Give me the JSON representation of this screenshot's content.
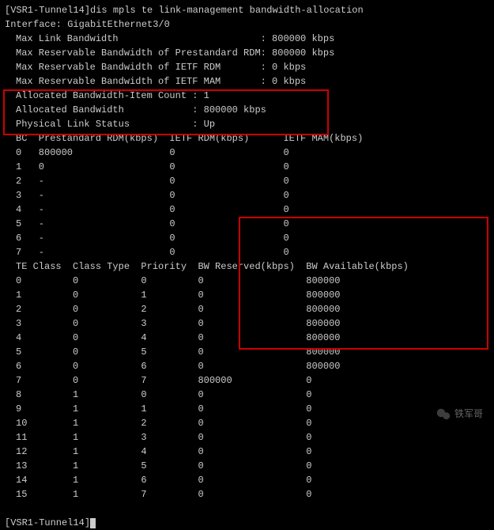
{
  "prompt1": "[VSR1-Tunnel14]",
  "command": "dis mpls te link-management bandwidth-allocation",
  "interface_line": "Interface: GigabitEthernet3/0",
  "header_rows": [
    {
      "label": "Max Link Bandwidth",
      "value": ": 800000 kbps"
    },
    {
      "label": "Max Reservable Bandwidth of Prestandard RDM",
      "value": ": 800000 kbps"
    },
    {
      "label": "Max Reservable Bandwidth of IETF RDM",
      "value": ": 0 kbps"
    },
    {
      "label": "Max Reservable Bandwidth of IETF MAM",
      "value": ": 0 kbps"
    },
    {
      "label": "Allocated Bandwidth-Item Count",
      "value": ": 1"
    },
    {
      "label": "Allocated Bandwidth",
      "value": ": 800000 kbps"
    },
    {
      "label": "Physical Link Status",
      "value": ": Up"
    }
  ],
  "bc_header": {
    "c0": "BC",
    "c1": "Prestandard RDM(kbps)",
    "c2": "IETF RDM(kbps)",
    "c3": "IETF MAM(kbps)"
  },
  "bc_rows": [
    {
      "bc": "0",
      "pre": "800000",
      "ietf_rdm": "0",
      "ietf_mam": "0"
    },
    {
      "bc": "1",
      "pre": "0",
      "ietf_rdm": "0",
      "ietf_mam": "0"
    },
    {
      "bc": "2",
      "pre": "-",
      "ietf_rdm": "0",
      "ietf_mam": "0"
    },
    {
      "bc": "3",
      "pre": "-",
      "ietf_rdm": "0",
      "ietf_mam": "0"
    },
    {
      "bc": "4",
      "pre": "-",
      "ietf_rdm": "0",
      "ietf_mam": "0"
    },
    {
      "bc": "5",
      "pre": "-",
      "ietf_rdm": "0",
      "ietf_mam": "0"
    },
    {
      "bc": "6",
      "pre": "-",
      "ietf_rdm": "0",
      "ietf_mam": "0"
    },
    {
      "bc": "7",
      "pre": "-",
      "ietf_rdm": "0",
      "ietf_mam": "0"
    }
  ],
  "te_header": {
    "c0": "TE Class",
    "c1": "Class Type",
    "c2": "Priority",
    "c3": "BW Reserved(kbps)",
    "c4": "BW Available(kbps)"
  },
  "te_rows": [
    {
      "cls": "0",
      "type": "0",
      "pri": "0",
      "res": "0",
      "avail": "800000"
    },
    {
      "cls": "1",
      "type": "0",
      "pri": "1",
      "res": "0",
      "avail": "800000"
    },
    {
      "cls": "2",
      "type": "0",
      "pri": "2",
      "res": "0",
      "avail": "800000"
    },
    {
      "cls": "3",
      "type": "0",
      "pri": "3",
      "res": "0",
      "avail": "800000"
    },
    {
      "cls": "4",
      "type": "0",
      "pri": "4",
      "res": "0",
      "avail": "800000"
    },
    {
      "cls": "5",
      "type": "0",
      "pri": "5",
      "res": "0",
      "avail": "800000"
    },
    {
      "cls": "6",
      "type": "0",
      "pri": "6",
      "res": "0",
      "avail": "800000"
    },
    {
      "cls": "7",
      "type": "0",
      "pri": "7",
      "res": "800000",
      "avail": "0"
    },
    {
      "cls": "8",
      "type": "1",
      "pri": "0",
      "res": "0",
      "avail": "0"
    },
    {
      "cls": "9",
      "type": "1",
      "pri": "1",
      "res": "0",
      "avail": "0"
    },
    {
      "cls": "10",
      "type": "1",
      "pri": "2",
      "res": "0",
      "avail": "0"
    },
    {
      "cls": "11",
      "type": "1",
      "pri": "3",
      "res": "0",
      "avail": "0"
    },
    {
      "cls": "12",
      "type": "1",
      "pri": "4",
      "res": "0",
      "avail": "0"
    },
    {
      "cls": "13",
      "type": "1",
      "pri": "5",
      "res": "0",
      "avail": "0"
    },
    {
      "cls": "14",
      "type": "1",
      "pri": "6",
      "res": "0",
      "avail": "0"
    },
    {
      "cls": "15",
      "type": "1",
      "pri": "7",
      "res": "0",
      "avail": "0"
    }
  ],
  "prompt2": "[VSR1-Tunnel14]",
  "watermark": "铁军哥",
  "chart_data": {
    "type": "table",
    "title": "MPLS TE Link-Management Bandwidth-Allocation",
    "interface": "GigabitEthernet3/0",
    "max_link_bandwidth_kbps": 800000,
    "max_reservable_prestandard_rdm_kbps": 800000,
    "max_reservable_ietf_rdm_kbps": 0,
    "max_reservable_ietf_mam_kbps": 0,
    "allocated_bandwidth_item_count": 1,
    "allocated_bandwidth_kbps": 800000,
    "physical_link_status": "Up",
    "bc_table": {
      "columns": [
        "BC",
        "Prestandard RDM(kbps)",
        "IETF RDM(kbps)",
        "IETF MAM(kbps)"
      ],
      "rows": [
        [
          0,
          800000,
          0,
          0
        ],
        [
          1,
          0,
          0,
          0
        ],
        [
          2,
          null,
          0,
          0
        ],
        [
          3,
          null,
          0,
          0
        ],
        [
          4,
          null,
          0,
          0
        ],
        [
          5,
          null,
          0,
          0
        ],
        [
          6,
          null,
          0,
          0
        ],
        [
          7,
          null,
          0,
          0
        ]
      ]
    },
    "te_class_table": {
      "columns": [
        "TE Class",
        "Class Type",
        "Priority",
        "BW Reserved(kbps)",
        "BW Available(kbps)"
      ],
      "rows": [
        [
          0,
          0,
          0,
          0,
          800000
        ],
        [
          1,
          0,
          1,
          0,
          800000
        ],
        [
          2,
          0,
          2,
          0,
          800000
        ],
        [
          3,
          0,
          3,
          0,
          800000
        ],
        [
          4,
          0,
          4,
          0,
          800000
        ],
        [
          5,
          0,
          5,
          0,
          800000
        ],
        [
          6,
          0,
          6,
          0,
          800000
        ],
        [
          7,
          0,
          7,
          800000,
          0
        ],
        [
          8,
          1,
          0,
          0,
          0
        ],
        [
          9,
          1,
          1,
          0,
          0
        ],
        [
          10,
          1,
          2,
          0,
          0
        ],
        [
          11,
          1,
          3,
          0,
          0
        ],
        [
          12,
          1,
          4,
          0,
          0
        ],
        [
          13,
          1,
          5,
          0,
          0
        ],
        [
          14,
          1,
          6,
          0,
          0
        ],
        [
          15,
          1,
          7,
          0,
          0
        ]
      ]
    }
  }
}
